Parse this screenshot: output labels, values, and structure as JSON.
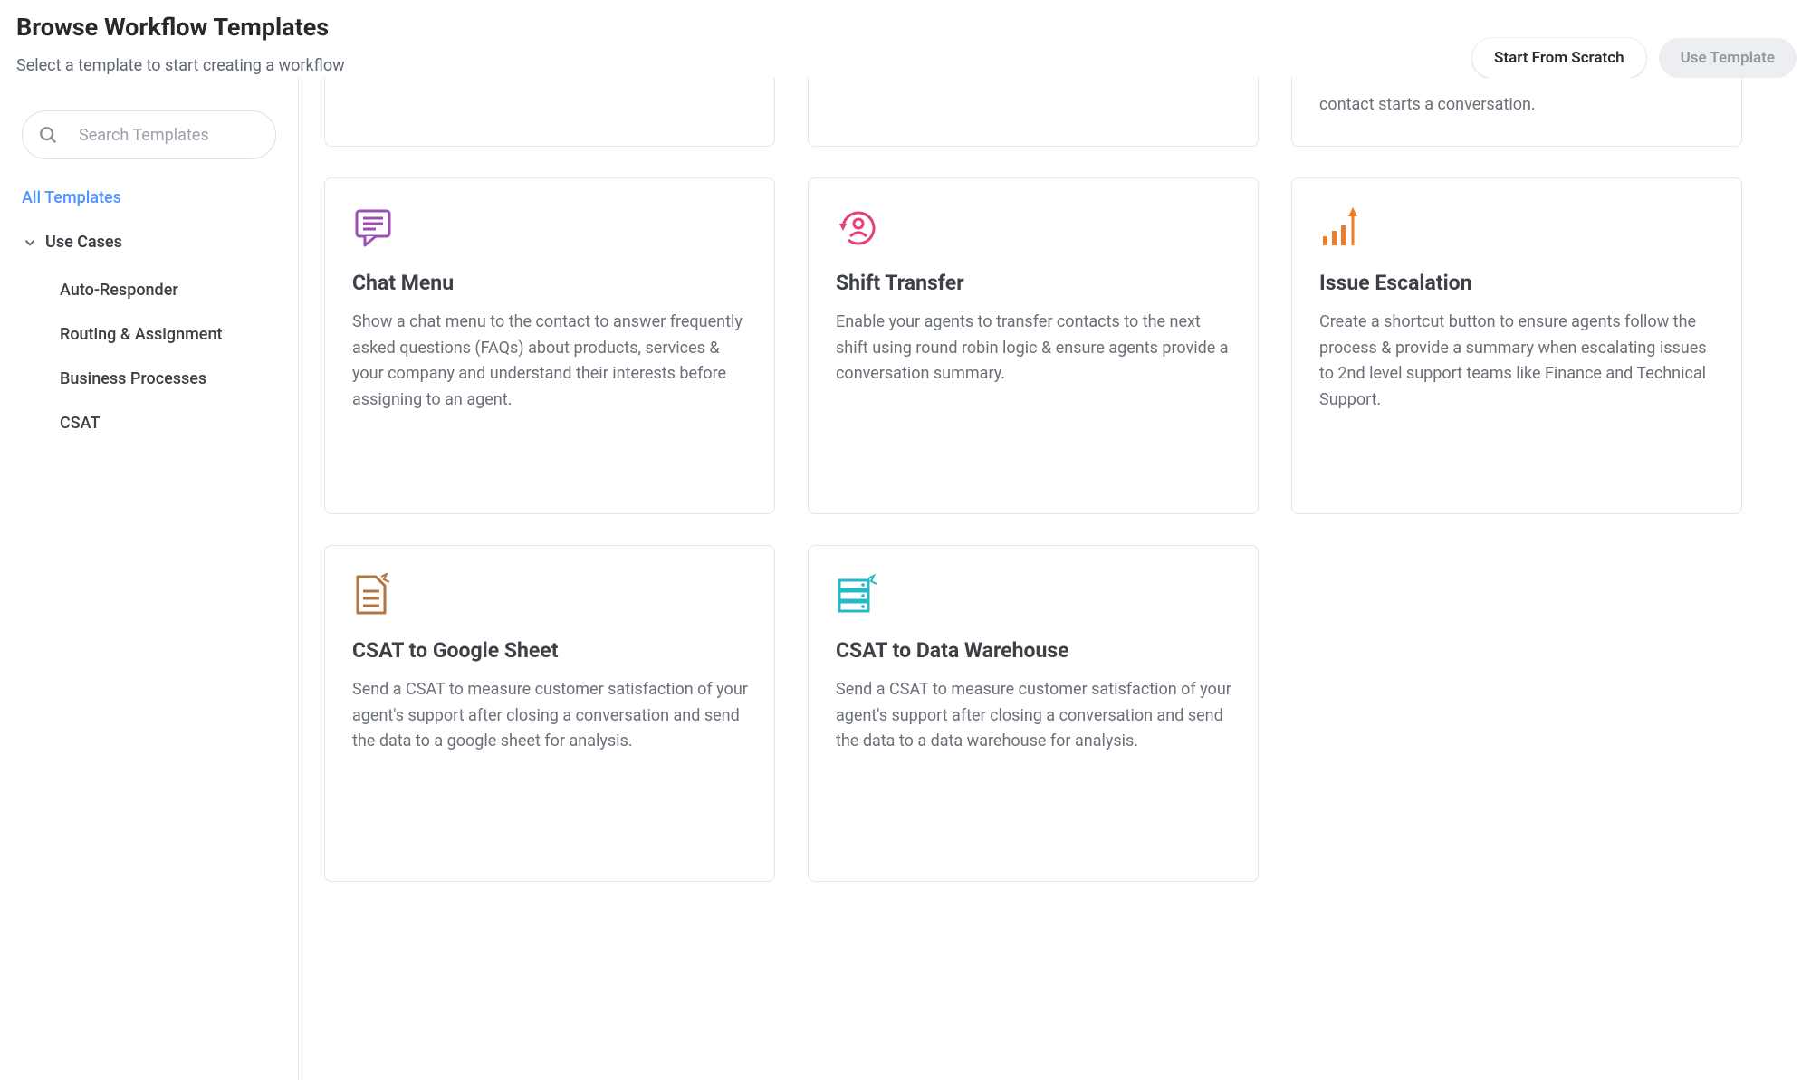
{
  "header": {
    "title": "Browse Workflow Templates",
    "subtitle": "Select a template to start creating a workflow",
    "start_from_scratch": "Start From Scratch",
    "use_template": "Use Template"
  },
  "search": {
    "placeholder": "Search Templates"
  },
  "sidebar": {
    "all_templates": "All Templates",
    "use_cases": "Use Cases",
    "items": [
      "Auto-Responder",
      "Routing & Assignment",
      "Business Processes",
      "CSAT"
    ]
  },
  "partial_row": {
    "fragment": "contact starts a conversation."
  },
  "cards": [
    {
      "title": "Chat Menu",
      "desc": "Show a chat menu to the contact to answer frequently asked questions (FAQs) about products, services & your company and understand their interests before assigning to an agent.",
      "icon": "chat"
    },
    {
      "title": "Shift Transfer",
      "desc": "Enable your agents to transfer contacts to the next shift using round robin logic & ensure agents provide a conversation summary.",
      "icon": "shift"
    },
    {
      "title": "Issue Escalation",
      "desc": "Create a shortcut button to ensure agents follow the process & provide a summary when escalating issues to 2nd level support teams like Finance and Technical Support.",
      "icon": "escalation"
    },
    {
      "title": "CSAT to Google Sheet",
      "desc": "Send a CSAT to measure customer satisfaction of your agent's support after closing a conversation and send the data to a google sheet for analysis.",
      "icon": "sheet"
    },
    {
      "title": "CSAT to Data Warehouse",
      "desc": "Send a CSAT to measure customer satisfaction of your agent's support after closing a conversation and send the data to a data warehouse for analysis.",
      "icon": "warehouse"
    }
  ]
}
